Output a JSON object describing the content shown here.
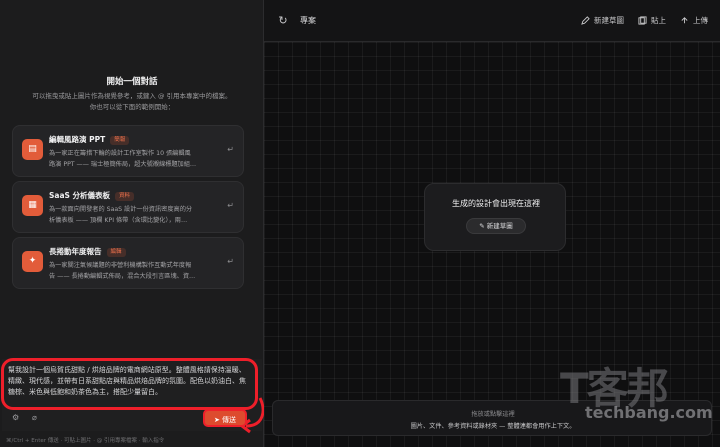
{
  "header": {
    "title": "專案",
    "actions": [
      {
        "label": "新建草圖",
        "icon": "pencil-icon"
      },
      {
        "label": "貼上",
        "icon": "paste-icon"
      },
      {
        "label": "上傳",
        "icon": "upload-icon"
      }
    ]
  },
  "welcome": {
    "title": "開始一個對話",
    "subtitle": "可以拖曳或貼上圖片作為視覺參考，或鍵入 @ 引用本專案中的檔案。你也可以從下面的範例開始："
  },
  "examples": [
    {
      "title": "編輯風路演 PPT",
      "badge": "簡報",
      "desc1": "為一家正在籌措下輪的設計工作室製作 10 張編輯風",
      "desc2": "路演 PPT —— 瑞士極簡佈局，超大號襯線標題加組…",
      "icon": "slides-icon"
    },
    {
      "title": "SaaS 分析儀表板",
      "badge": "資料",
      "desc1": "為一款面向開發者的 SaaS 設計一份資訊密度高的分",
      "desc2": "析儀表板 —— 頂欄 KPI 條帶（含環比變化），兩…",
      "icon": "dashboard-icon"
    },
    {
      "title": "長捲動年度報告",
      "badge": "編輯",
      "desc1": "為一家關注氣候議題的非營利機構製作互動式年度報",
      "desc2": "告 —— 長捲動編輯式佈局，混合大段引言區塊、資…",
      "icon": "report-icon"
    }
  ],
  "composer": {
    "text": "幫我設計一個烏賀氏甜點 / 烘焙品牌的電商網站原型。整體風格請保持溫暖、精緻、現代感，並帶有日系甜點店與精品烘焙品牌的氛圍。配色以奶油白、焦糖棕、米色與低飽和奶茶色為主，搭配少量留白。",
    "send_label": "傳送",
    "hint": "⌘/Ctrl + Enter 傳送 · 可貼上圖片 · @ 引用專案檔案 · 輸入指令"
  },
  "canvas": {
    "placeholder": "生成的設計會出現在這裡",
    "new_sketch": "新建草圖"
  },
  "dropzone": {
    "title": "拖放或點擊這裡",
    "subtitle": "圖片、文件、參考資料或錄材夾 — 整體連都會用作上下文。"
  },
  "watermark": {
    "logo": "T客邦",
    "site": "techbang.com"
  },
  "colors": {
    "accent": "#e25c3a",
    "highlight": "#ee1f2a"
  }
}
